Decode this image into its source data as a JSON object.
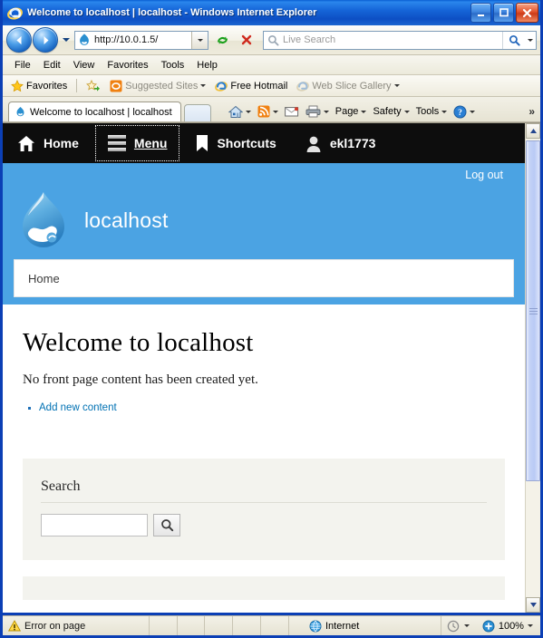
{
  "window": {
    "title": "Welcome to localhost | localhost - Windows Internet Explorer",
    "minimize_label": "Minimize",
    "maximize_label": "Maximize",
    "close_label": "Close"
  },
  "browser": {
    "back_label": "Back",
    "forward_label": "Forward",
    "recent_pages_label": "Recent Pages",
    "address": {
      "value": "http://10.0.1.5/",
      "favicon": "drupal-favicon",
      "dropdown_label": "Address dropdown"
    },
    "refresh_label": "Refresh",
    "stop_label": "Stop",
    "search": {
      "placeholder": "Live Search",
      "go_label": "Search",
      "dropdown_label": "Search provider"
    },
    "menu": [
      "File",
      "Edit",
      "View",
      "Favorites",
      "Tools",
      "Help"
    ],
    "favorites_bar": {
      "favorites_label": "Favorites",
      "add_label": "Add to Favorites Bar",
      "items": [
        {
          "label": "Suggested Sites",
          "icon": "suggested-sites-icon",
          "dim": true,
          "dropdown": true
        },
        {
          "label": "Free Hotmail",
          "icon": "ie-icon",
          "dim": false,
          "dropdown": false
        },
        {
          "label": "Web Slice Gallery",
          "icon": "ie-icon",
          "dim": true,
          "dropdown": true
        }
      ]
    },
    "tabs": [
      {
        "label": "Welcome to localhost | localhost",
        "favicon": "drupal-favicon",
        "active": true
      }
    ],
    "new_tab_label": "New Tab",
    "command_bar": {
      "home_label": "Home",
      "feeds_label": "Feeds",
      "read_mail_label": "Read Mail",
      "print_label": "Print",
      "page_label": "Page",
      "safety_label": "Safety",
      "tools_label": "Tools",
      "help_label": "Help",
      "overflow_label": "»"
    }
  },
  "page": {
    "admin_toolbar": [
      {
        "label": "Home",
        "icon": "house-icon",
        "focused": false
      },
      {
        "label": "Menu",
        "icon": "hamburger-icon",
        "focused": true
      },
      {
        "label": "Shortcuts",
        "icon": "bookmark-icon",
        "focused": false
      },
      {
        "label": "ekl1773",
        "icon": "user-icon",
        "focused": false
      }
    ],
    "header": {
      "logout_label": "Log out",
      "site_name": "localhost",
      "logo": "drupal-droplet-logo",
      "background_color": "#4ba3e3"
    },
    "primary_nav": [
      {
        "label": "Home",
        "active": true
      }
    ],
    "content": {
      "title": "Welcome to localhost",
      "paragraph": "No front page content has been created yet.",
      "links": [
        {
          "label": "Add new content"
        }
      ]
    },
    "search_block": {
      "title": "Search",
      "input_value": "",
      "button_label": "Search",
      "button_icon": "magnifier-icon"
    }
  },
  "statusbar": {
    "error_text": "Error on page",
    "error_icon": "warning-icon",
    "zone_text": "Internet",
    "zone_icon": "globe-icon",
    "protected_icon": "protected-mode-icon",
    "zoom_text": "100%",
    "zoom_icon": "zoom-icon"
  }
}
